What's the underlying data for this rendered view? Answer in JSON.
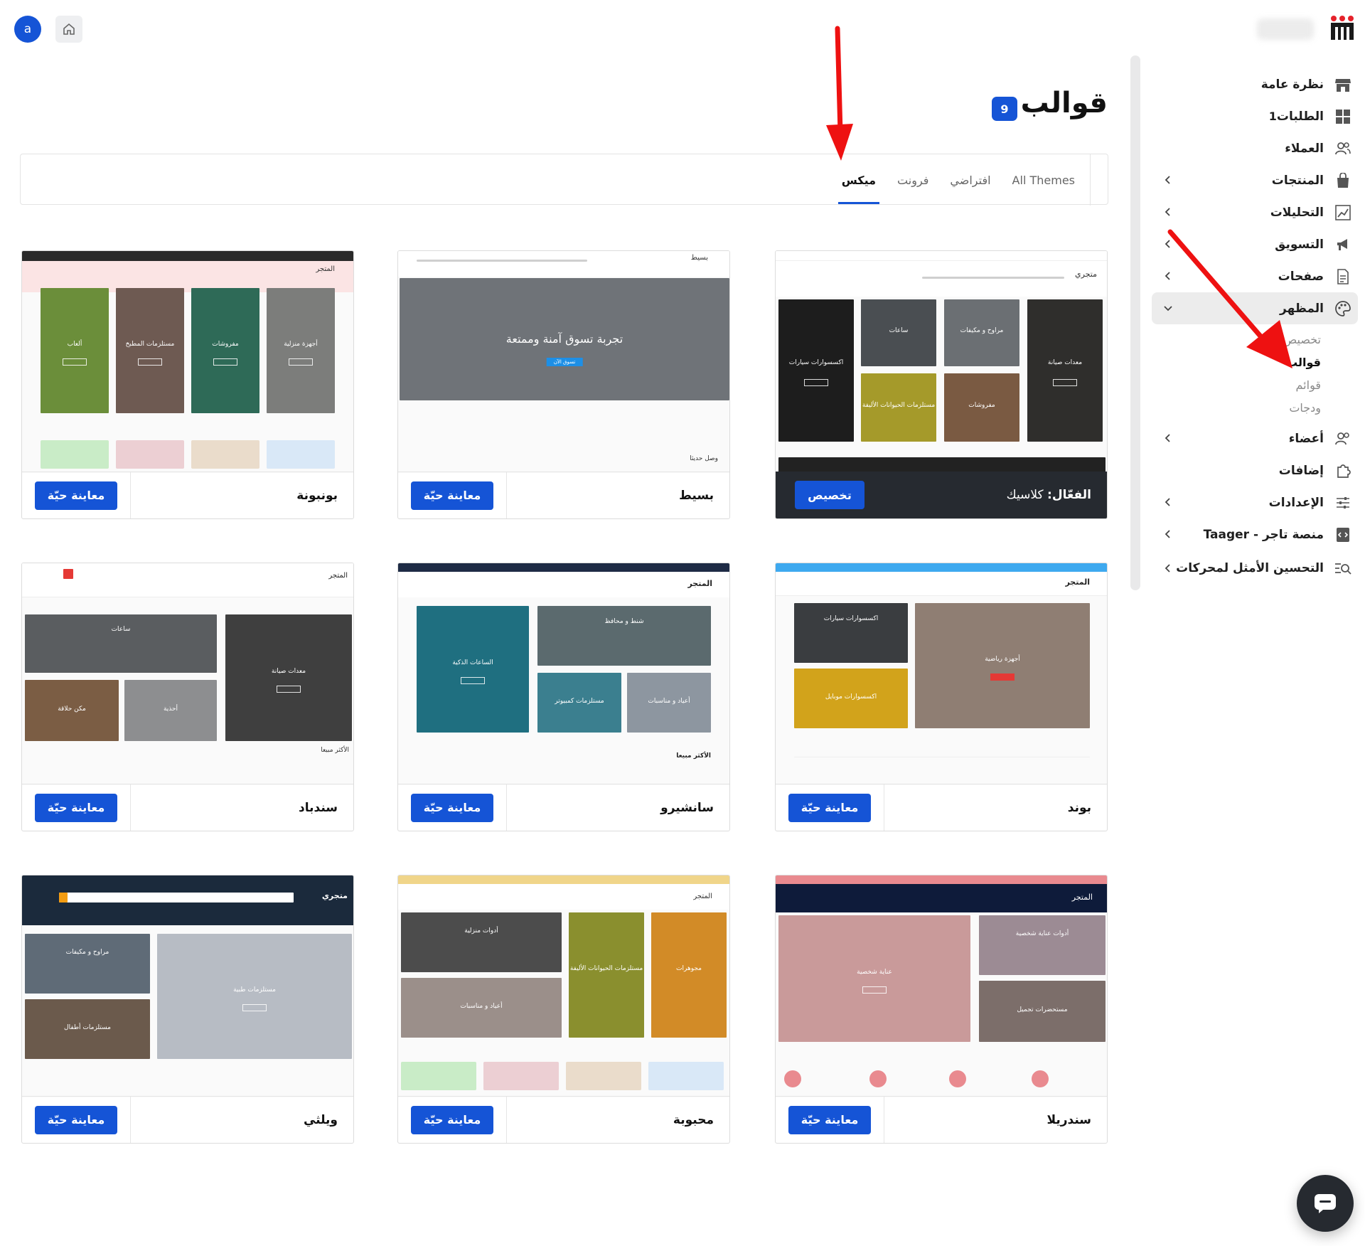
{
  "topbar": {
    "avatar_letter": "a"
  },
  "header": {
    "title": "قوالب",
    "count": "9"
  },
  "tabs": [
    {
      "label": "All Themes",
      "active": false
    },
    {
      "label": "افتراضي",
      "active": false
    },
    {
      "label": "فرونت",
      "active": false
    },
    {
      "label": "ميكس",
      "active": true
    }
  ],
  "sidebar": {
    "items": [
      {
        "label": "نظرة عامة",
        "icon": "store-icon",
        "chevron": false
      },
      {
        "label": "الطلبات",
        "icon": "grid-icon",
        "count": "1",
        "chevron": false
      },
      {
        "label": "العملاء",
        "icon": "users-icon",
        "chevron": false
      },
      {
        "label": "المنتجات",
        "icon": "bag-icon",
        "chevron": true
      },
      {
        "label": "التحليلات",
        "icon": "chart-icon",
        "chevron": true
      },
      {
        "label": "التسويق",
        "icon": "megaphone-icon",
        "chevron": true
      },
      {
        "label": "صفحات",
        "icon": "page-icon",
        "chevron": true
      },
      {
        "label": "المظهر",
        "icon": "palette-icon",
        "chevron": true,
        "expanded": true
      }
    ],
    "appearance_sub": [
      {
        "label": "تخصيص",
        "current": false
      },
      {
        "label": "قوالب",
        "current": true
      },
      {
        "label": "قوائم",
        "current": false
      },
      {
        "label": "ودجات",
        "current": false
      }
    ],
    "items_after": [
      {
        "label": "أعضاء",
        "icon": "members-icon",
        "chevron": true
      },
      {
        "label": "إضافات",
        "icon": "puzzle-icon",
        "chevron": false
      },
      {
        "label": "الإعدادات",
        "icon": "sliders-icon",
        "chevron": true
      },
      {
        "label": "Taager - منصة تاجر",
        "icon": "taager-icon",
        "chevron": true
      },
      {
        "label": "التحسين الأمثل لمحركات",
        "icon": "seo-icon",
        "chevron": true
      }
    ]
  },
  "themes": [
    {
      "name": "كلاسيك",
      "active_prefix": "الفعّال:",
      "button": "تخصيص",
      "active": true
    },
    {
      "name": "بسيط",
      "button": "معاينة حيّة"
    },
    {
      "name": "بونبونة",
      "button": "معاينة حيّة"
    },
    {
      "name": "بوند",
      "button": "معاينة حيّة"
    },
    {
      "name": "سانشيرو",
      "button": "معاينة حيّة"
    },
    {
      "name": "سندباد",
      "button": "معاينة حيّة"
    },
    {
      "name": "سندريلا",
      "button": "معاينة حيّة"
    },
    {
      "name": "محبوبة",
      "button": "معاينة حيّة"
    },
    {
      "name": "ويلثي",
      "button": "معاينة حيّة"
    }
  ],
  "previews": {
    "classic": {
      "store": "متجري",
      "tiles": [
        "معدات صيانة",
        "مراوح و مكيفات",
        "ساعات",
        "اكسسوارات سيارات",
        "مفروشات",
        "مستلزمات الحيوانات الأليفة"
      ]
    },
    "simple": {
      "store": "بسيط",
      "hero": "تجربة تسوق آمنة وممتعة",
      "hero_btn": "تسوق الآن",
      "section": "وصل حديثا"
    },
    "bonbona": {
      "store": "المتجر",
      "tiles": [
        "أجهزة منزلية",
        "مفروشات",
        "مستلزمات المطبخ",
        "ألعاب"
      ]
    },
    "bond": {
      "store": "المتجر",
      "tiles": [
        "اكسسوارات سيارات",
        "أجهزة رياضية",
        "اكسسوارات موبايل"
      ]
    },
    "sanshiro": {
      "store": "المتجر",
      "tiles": [
        "الساعات الذكية",
        "شنط و محافظ",
        "مستلزمات كمبيوتر",
        "أعياد و مناسبات"
      ],
      "section": "الأكثر مبيعا"
    },
    "sindbad": {
      "store": "المتجر",
      "tiles": [
        "ساعات",
        "معدات صيانة",
        "مكن حلاقة",
        "أحذية"
      ],
      "section": "الأكثر مبيعا"
    },
    "cinderella": {
      "store": "المتجر",
      "tiles": [
        "عناية شخصية",
        "أدوات عناية شخصية",
        "مستحضرات تجميل"
      ]
    },
    "mahbouba": {
      "store": "المتجر",
      "tiles": [
        "أدوات منزلية",
        "مستلزمات الحيوانات الأليفة",
        "مجوهرات",
        "أعياد و مناسبات"
      ]
    },
    "wealthy": {
      "store": "متجري",
      "tiles": [
        "مراوح و مكيفات",
        "مستلزمات طبية",
        "مستلزمات أطفال"
      ]
    }
  },
  "colors": {
    "accent": "#1554d6",
    "active_footer": "#262a30",
    "arrow": "#ee1111"
  }
}
